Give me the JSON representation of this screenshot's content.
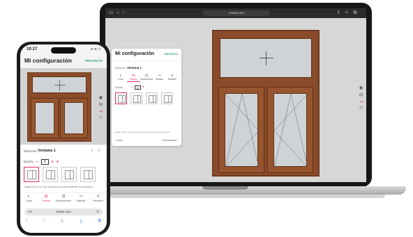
{
  "laptop": {
    "url": "venau.com",
    "panel": {
      "title": "Mi configuración",
      "project_label": "PROYECTO",
      "selector_label": "Elemento",
      "element_name": "Ventana 1",
      "tabs": [
        {
          "label": "Color",
          "icon": "color-icon"
        },
        {
          "label": "Diseño",
          "icon": "design-icon",
          "active": true
        },
        {
          "label": "Dimensiones",
          "icon": "dimensions-icon"
        },
        {
          "label": "Manilla",
          "icon": "handle-icon"
        },
        {
          "label": "Revisión",
          "icon": "review-icon"
        }
      ],
      "design_label": "Diseño",
      "design_value": "3",
      "help_text": "Haga click en el tipo de apertura para cambiar su selección",
      "footer_left": "‹ Color",
      "footer_right": "Dimensiones ›"
    }
  },
  "phone": {
    "time": "10:27",
    "status": "▪▪ ≋ ▭",
    "title": "Mi configuración",
    "project_label": "PROYECTO",
    "selector_label": "Elemento",
    "element_name": "Ventana 1",
    "design_label": "Diseño",
    "design_value": "3",
    "help_text": "Haga click en el tipo de apertura para cambiar su selección.",
    "tabs": [
      {
        "label": "Color",
        "icon": "color-icon"
      },
      {
        "label": "Diseño",
        "icon": "design-icon",
        "active": true
      },
      {
        "label": "Dimensiones",
        "icon": "dimensions-icon"
      },
      {
        "label": "Manilla",
        "icon": "handle-icon"
      },
      {
        "label": "Revisión",
        "icon": "review-icon"
      }
    ],
    "url_aa": "AA",
    "url": "venau.com"
  },
  "colors": {
    "accent": "#e0306a",
    "brand_green": "#2a9d6a",
    "frame_wood": "#8a4b2a"
  }
}
